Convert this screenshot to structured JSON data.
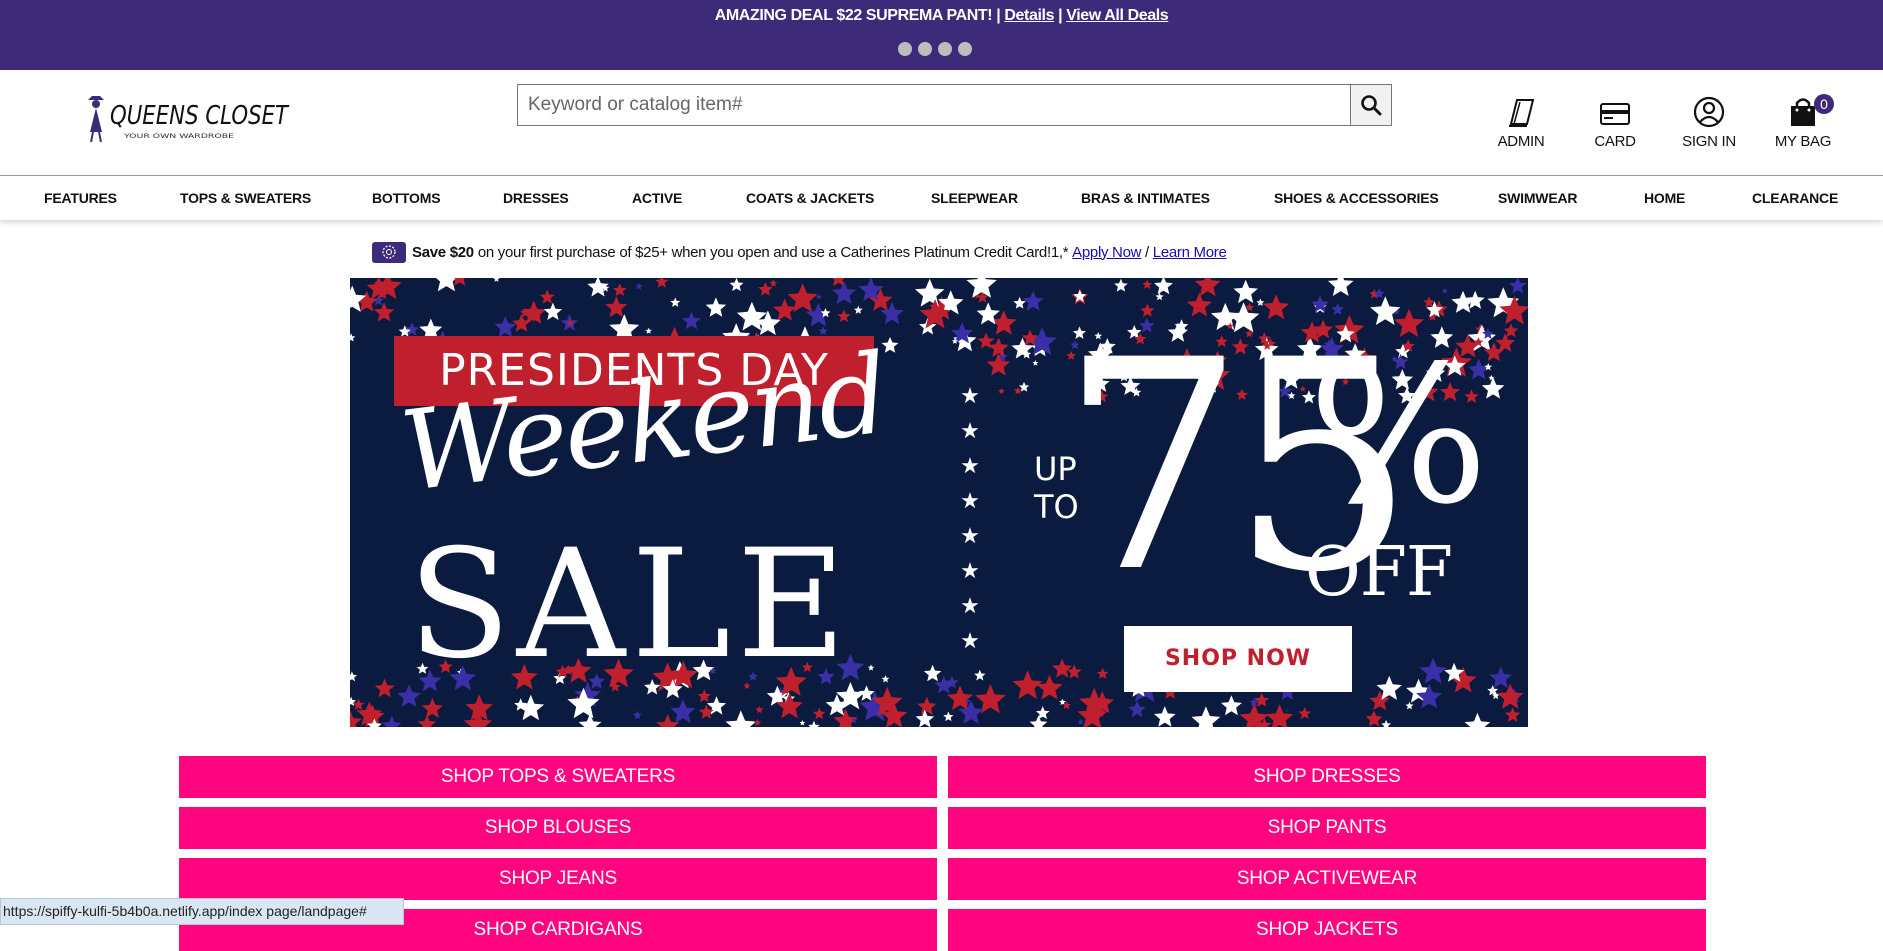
{
  "promo": {
    "deal_text": "AMAZING DEAL $22 SUPREMA PANT!",
    "sep1": "|",
    "details_link": "Details",
    "sep2": "|",
    "view_all_link": "View All Deals"
  },
  "logo": {
    "brand": "QUEENS CLOSET",
    "tagline": "YOUR OWN WARDROBE"
  },
  "search": {
    "placeholder": "Keyword or catalog item#",
    "value": ""
  },
  "header_links": [
    {
      "label": "ADMIN",
      "icon": "admin-notebook-icon"
    },
    {
      "label": "CARD",
      "icon": "credit-card-icon"
    },
    {
      "label": "SIGN IN",
      "icon": "user-circle-icon"
    },
    {
      "label": "MY BAG",
      "icon": "shopping-bag-icon",
      "count": "0"
    }
  ],
  "nav": [
    "FEATURES",
    "TOPS & SWEATERS",
    "BOTTOMS",
    "DRESSES",
    "ACTIVE",
    "COATS & JACKETS",
    "SLEEPWEAR",
    "BRAS & INTIMATES",
    "SHOES & ACCESSORIES",
    "SWIMWEAR",
    "HOME",
    "CLEARANCE"
  ],
  "credit_offer": {
    "bold": "Save $20",
    "text": "on your first purchase of $25+ when you open and use a Catherines Platinum Credit Card!1,*",
    "apply_link": "Apply Now",
    "slash": "/",
    "learn_link": "Learn More"
  },
  "hero": {
    "ribbon": "PRESIDENTS DAY",
    "script": "Weekend",
    "sale": "SALE",
    "up": "UP",
    "to": "TO",
    "amount": "75",
    "percent": "%",
    "off": "OFF",
    "cta": "SHOP NOW",
    "colors": {
      "background": "#0b1b3f",
      "red": "#c0202e",
      "blue": "#3b2fa8",
      "white": "#ffffff"
    }
  },
  "shop_buttons": [
    "SHOP TOPS & SWEATERS",
    "SHOP DRESSES",
    "SHOP BLOUSES",
    "SHOP PANTS",
    "SHOP JEANS",
    "SHOP ACTIVEWEAR",
    "SHOP CARDIGANS",
    "SHOP JACKETS"
  ],
  "status_url": "https://spiffy-kulfi-5b4b0a.netlify.app/index page/landpage#",
  "colors": {
    "promo_bar": "#3d2b7a",
    "shop_button": "#ff0580"
  }
}
